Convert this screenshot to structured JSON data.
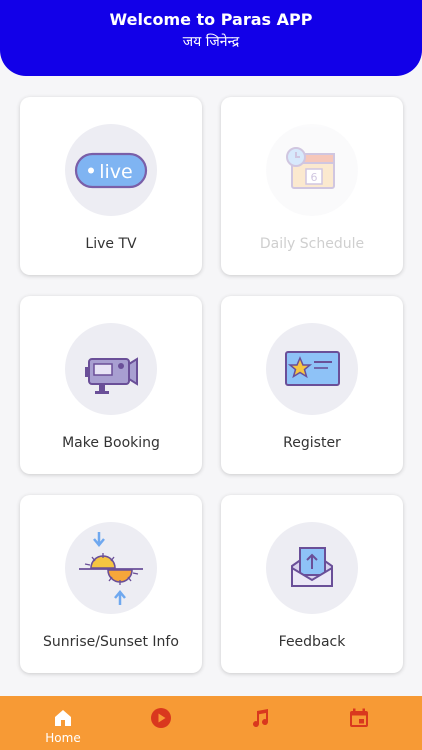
{
  "header": {
    "title": "Welcome to Paras APP",
    "subtitle": "जय जिनेन्द्र"
  },
  "tiles": [
    {
      "label": "Live TV",
      "icon": "live-tv-icon",
      "icon_text": "live",
      "enabled": true
    },
    {
      "label": "Daily Schedule",
      "icon": "calendar-clock-icon",
      "icon_text": "6",
      "enabled": false
    },
    {
      "label": "Make Booking",
      "icon": "video-camera-icon",
      "enabled": true
    },
    {
      "label": "Register",
      "icon": "star-card-icon",
      "enabled": true
    },
    {
      "label": "Sunrise/Sunset Info",
      "icon": "sunrise-sunset-icon",
      "enabled": true
    },
    {
      "label": "Feedback",
      "icon": "mail-upload-icon",
      "enabled": true
    }
  ],
  "bottom_nav": [
    {
      "label": "Home",
      "icon": "home-icon",
      "active": true
    },
    {
      "label": "",
      "icon": "play-circle-icon",
      "active": false
    },
    {
      "label": "",
      "icon": "music-note-icon",
      "active": false
    },
    {
      "label": "",
      "icon": "calendar-icon",
      "active": false
    }
  ],
  "colors": {
    "header_bg": "#1200e8",
    "nav_bg": "#f79a35",
    "nav_icon": "#d9381e",
    "icon_blue": "#6fa8ef",
    "icon_purple": "#7a5fa8"
  }
}
